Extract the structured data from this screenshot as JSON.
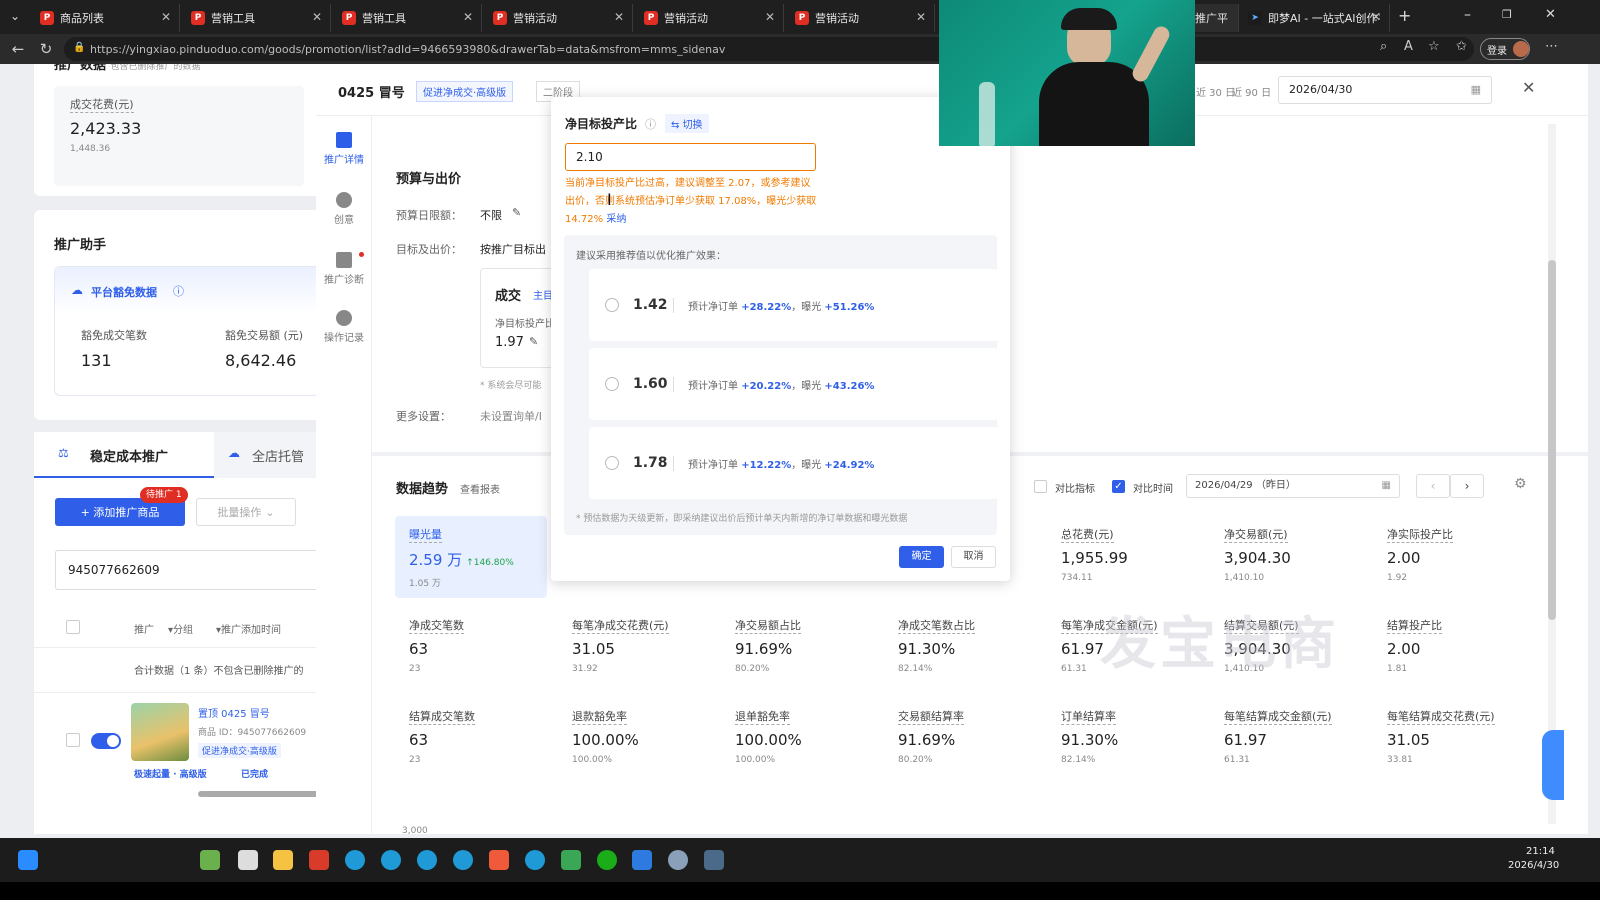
{
  "browser": {
    "tabs": [
      {
        "label": "商品列表"
      },
      {
        "label": "营销工具"
      },
      {
        "label": "营销工具"
      },
      {
        "label": "营销活动"
      },
      {
        "label": "营销活动"
      },
      {
        "label": "营销活动"
      },
      {
        "label": "推广平"
      },
      {
        "label": "即梦AI - 一站式AI创作平"
      }
    ],
    "url": "https://yingxiao.pinduoduo.com/goods/promotion/list?adId=9466593980&drawerTab=data&msfrom=mms_sidenav",
    "profile_label": "登录"
  },
  "left": {
    "top_section": "推广数据",
    "top_note": "包含已删除推广的数据",
    "cost_label": "成交花费(元)",
    "cost_value": "2,423.33",
    "cost_prev": "1,448.36",
    "assistant_title": "推广助手",
    "platform_free_title": "平台豁免数据",
    "free_orders_label": "豁免成交笔数",
    "free_orders_value": "131",
    "free_amount_label": "豁免交易额 (元)",
    "free_amount_value": "8,642.46",
    "tab_stable": "稳定成本推广",
    "tab_full": "全店托管",
    "add_button": "+ 添加推广商品",
    "pending_badge": "待推广 1",
    "batch_button": "批量操作",
    "search_value": "945077662609",
    "col_promo": "推广",
    "col_group": "分组",
    "col_time": "推广添加时间",
    "summary_row": "合计数据（1 条）不包含已删除推广的",
    "item_title": "置顶  0425 冒号",
    "item_id": "商品 ID：945077662609",
    "item_tag": "促进净成交·高级版",
    "item_status_a": "极速起量 · 高级版",
    "item_status_b": "已完成"
  },
  "drawer": {
    "title": "0425 冒号",
    "tag1": "促进净成交·高级版",
    "tag2": "二阶段",
    "range_30": "近 30 日",
    "range_90": "近 90 日",
    "date_value": "2026/04/30",
    "vtabs": [
      "推广详情",
      "创意",
      "推广诊断",
      "操作记录"
    ],
    "budget_title": "预算与出价",
    "daily_budget_label": "预算日限额：",
    "daily_budget_value": "不限",
    "bid_label": "目标及出价：",
    "bid_value": "按推广目标出",
    "deal_label": "成交",
    "deal_tag": "主目",
    "roi_label": "净目标投产比",
    "roi_value": "1.97",
    "sys_note": "* 系统会尽可能",
    "more_label": "更多设置：",
    "more_value": "未设置询单/I",
    "trend_title": "数据趋势",
    "trend_link": "查看报表",
    "compare_metric": "对比指标",
    "compare_time": "对比时间",
    "compare_date": "2026/04/29 （昨日）",
    "axis_tick": "3,000",
    "metrics": [
      {
        "t": "曝光量",
        "v": "2.59 万",
        "delta": "↑146.80%",
        "p": "1.05 万",
        "sel": true
      },
      {
        "t": "",
        "v": "",
        "p": "",
        "sel": false
      },
      {
        "t": "",
        "v": "",
        "p": "",
        "sel": false
      },
      {
        "t": "",
        "v": "",
        "p": "",
        "sel": false
      },
      {
        "t": "总花费(元)",
        "v": "1,955.99",
        "p": "734.11"
      },
      {
        "t": "净交易额(元)",
        "v": "3,904.30",
        "p": "1,410.10"
      },
      {
        "t": "净实际投产比",
        "v": "2.00",
        "p": "1.92"
      },
      {
        "t": "净成交笔数",
        "v": "63",
        "p": "23"
      },
      {
        "t": "每笔净成交花费(元)",
        "v": "31.05",
        "p": "31.92"
      },
      {
        "t": "净交易额占比",
        "v": "91.69%",
        "p": "80.20%"
      },
      {
        "t": "净成交笔数占比",
        "v": "91.30%",
        "p": "82.14%"
      },
      {
        "t": "每笔净成交金额(元)",
        "v": "61.97",
        "p": "61.31"
      },
      {
        "t": "结算交易额(元)",
        "v": "3,904.30",
        "p": "1,410.10"
      },
      {
        "t": "结算投产比",
        "v": "2.00",
        "p": "1.81"
      },
      {
        "t": "结算成交笔数",
        "v": "63",
        "p": "23"
      },
      {
        "t": "退款豁免率",
        "v": "100.00%",
        "p": "100.00%"
      },
      {
        "t": "退单豁免率",
        "v": "100.00%",
        "p": "100.00%"
      },
      {
        "t": "交易额结算率",
        "v": "91.69%",
        "p": "80.20%"
      },
      {
        "t": "订单结算率",
        "v": "91.30%",
        "p": "82.14%"
      },
      {
        "t": "每笔结算成交金额(元)",
        "v": "61.97",
        "p": "61.31"
      },
      {
        "t": "每笔结算成交花费(元)",
        "v": "31.05",
        "p": "33.81"
      }
    ]
  },
  "popover": {
    "title": "净目标投产比",
    "switch_label": "切换",
    "input_value": "2.10",
    "warning": "当前净目标投产比过高，建议调整至 2.07，或参考建议出价，否则系统预估净订单少获取 17.08%，曝光少获取 14.72%",
    "adopt_link": "采纳",
    "suggest_title": "建议采用推荐值以优化推广效果：",
    "options": [
      {
        "value": "1.42",
        "orders": "+28.22%",
        "exposure": "+51.26%"
      },
      {
        "value": "1.60",
        "orders": "+20.22%",
        "exposure": "+43.26%"
      },
      {
        "value": "1.78",
        "orders": "+12.22%",
        "exposure": "+24.92%"
      }
    ],
    "orders_prefix": "预计净订单",
    "exposure_prefix": "，曝光",
    "footnote": "* 预估数据为天级更新，即采纳建议出价后预计单天内新增的净订单数据和曝光数据",
    "confirm": "确定",
    "cancel": "取消"
  },
  "watermark": "发宝电商",
  "taskbar": {
    "time": "21:14",
    "date": "2026/4/30"
  },
  "colors": {
    "accent": "#2f5fe8",
    "warning": "#f07a00",
    "brand_red": "#e02e24"
  }
}
